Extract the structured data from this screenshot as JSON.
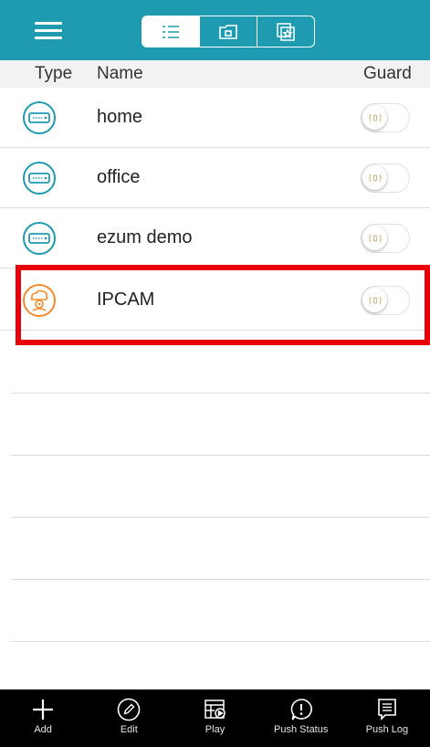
{
  "header": {
    "columns": {
      "type": "Type",
      "name": "Name",
      "guard": "Guard"
    }
  },
  "colors": {
    "accent": "#1e9bb0",
    "device_icon": "#1e9bb0",
    "ipcam_icon": "#f08a2a",
    "highlight": "#e8000b"
  },
  "devices": [
    {
      "name": "home",
      "icon": "nvr-recorder-icon",
      "guard_on": false
    },
    {
      "name": "office",
      "icon": "nvr-recorder-icon",
      "guard_on": false
    },
    {
      "name": "ezum demo",
      "icon": "nvr-recorder-icon",
      "guard_on": false
    },
    {
      "name": "IPCAM",
      "icon": "ip-camera-icon",
      "guard_on": false
    }
  ],
  "tabs": {
    "add": "Add",
    "edit": "Edit",
    "play": "Play",
    "push_status": "Push Status",
    "push_log": "Push Log"
  }
}
